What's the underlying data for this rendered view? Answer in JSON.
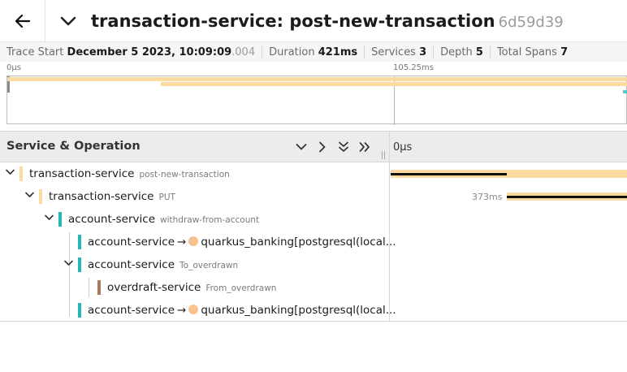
{
  "header": {
    "title": "transaction-service: post-new-transaction",
    "trace_id": "6d59d39"
  },
  "trace_info": {
    "start_label": "Trace Start",
    "start_value": "December 5 2023, 10:09:09",
    "start_ms": ".004",
    "duration_label": "Duration",
    "duration_value": "421ms",
    "services_label": "Services",
    "services_value": "3",
    "depth_label": "Depth",
    "depth_value": "5",
    "total_spans_label": "Total Spans",
    "total_spans_value": "7"
  },
  "minimap": {
    "tick_start": "0µs",
    "tick_mid": "105.25ms"
  },
  "columns": {
    "service_operation": "Service & Operation",
    "timeline_tick": "0µs"
  },
  "spans": [
    {
      "service": "transaction-service",
      "operation": "post-new-transaction",
      "color": "#fbdba0",
      "expandable": true
    },
    {
      "service": "transaction-service",
      "operation": "PUT",
      "color": "#fbdba0",
      "expandable": true,
      "duration": "373ms"
    },
    {
      "service": "account-service",
      "operation": "withdraw-from-account",
      "color": "#26b6b6",
      "expandable": true
    },
    {
      "service": "account-service",
      "peer": "quarkus_banking[postgresql(local...",
      "color": "#26b6b6",
      "expandable": false
    },
    {
      "service": "account-service",
      "operation": "To_overdrawn",
      "color": "#26b6b6",
      "expandable": true
    },
    {
      "service": "overdraft-service",
      "operation": "From_overdrawn",
      "color": "#a97a5c",
      "expandable": false
    },
    {
      "service": "account-service",
      "peer": "quarkus_banking[postgresql(local...",
      "color": "#26b6b6",
      "expandable": false
    }
  ],
  "icons": {
    "back": "arrow-left-icon",
    "collapse": "chevron-down-icon",
    "expand_down": "chevron-down-icon",
    "expand_right": "chevron-right-icon",
    "expand_all": "double-chevron-down-icon",
    "collapse_all": "double-chevron-right-icon"
  }
}
